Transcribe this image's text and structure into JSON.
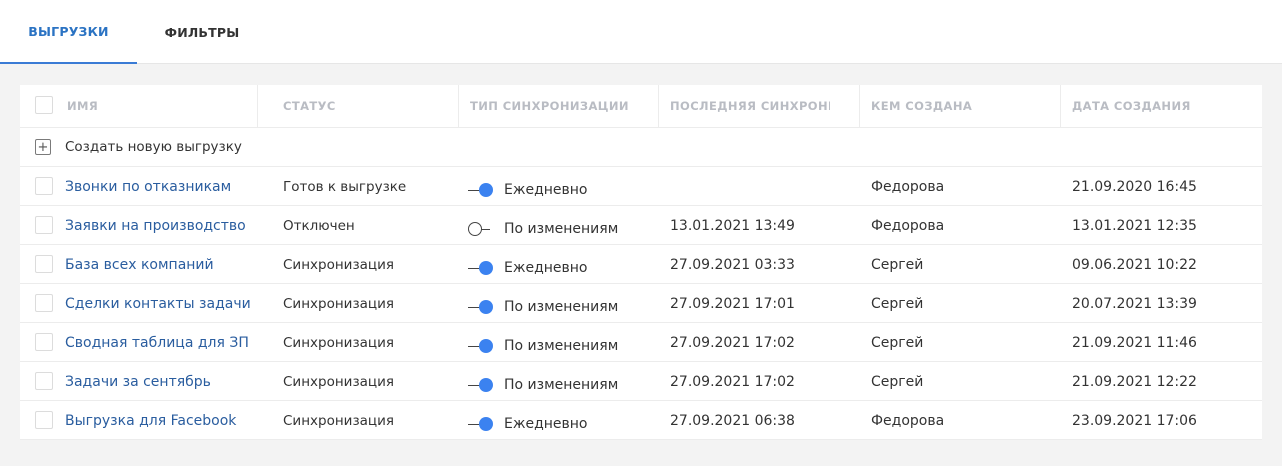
{
  "tabs": [
    {
      "label": "ВЫГРУЗКИ",
      "active": true
    },
    {
      "label": "ФИЛЬТРЫ",
      "active": false
    }
  ],
  "colors": {
    "accent": "#2b73c3",
    "toggle_on": "#3b82f0",
    "link": "#2a5d9f"
  },
  "table": {
    "columns": [
      "ИМЯ",
      "СТАТУС",
      "ТИП СИНХРОНИЗАЦИИ",
      "ПОСЛЕДНЯЯ СИНХРОНИЗАЦИЯ",
      "КЕМ СОЗДАНА",
      "ДАТА СОЗДАНИЯ"
    ],
    "create_label": "Создать новую выгрузку",
    "rows": [
      {
        "name": "Звонки по отказникам",
        "status": "Готов к выгрузке",
        "sync_on": true,
        "sync_type": "Ежедневно",
        "last_sync": "",
        "created_by": "Федорова",
        "created_at": "21.09.2020 16:45"
      },
      {
        "name": "Заявки на производство",
        "status": "Отключен",
        "sync_on": false,
        "sync_type": "По изменениям",
        "last_sync": "13.01.2021 13:49",
        "created_by": "Федорова",
        "created_at": "13.01.2021 12:35"
      },
      {
        "name": "База всех компаний",
        "status": "Синхронизация",
        "sync_on": true,
        "sync_type": "Ежедневно",
        "last_sync": "27.09.2021 03:33",
        "created_by": "Сергей",
        "created_at": "09.06.2021 10:22"
      },
      {
        "name": "Сделки контакты задачи",
        "status": "Синхронизация",
        "sync_on": true,
        "sync_type": "По изменениям",
        "last_sync": "27.09.2021 17:01",
        "created_by": "Сергей",
        "created_at": "20.07.2021 13:39"
      },
      {
        "name": "Сводная таблица для ЗП",
        "status": "Синхронизация",
        "sync_on": true,
        "sync_type": "По изменениям",
        "last_sync": "27.09.2021 17:02",
        "created_by": "Сергей",
        "created_at": "21.09.2021 11:46"
      },
      {
        "name": "Задачи за сентябрь",
        "status": "Синхронизация",
        "sync_on": true,
        "sync_type": "По изменениям",
        "last_sync": "27.09.2021 17:02",
        "created_by": "Сергей",
        "created_at": "21.09.2021 12:22"
      },
      {
        "name": "Выгрузка для Facebook",
        "status": "Синхронизация",
        "sync_on": true,
        "sync_type": "Ежедневно",
        "last_sync": "27.09.2021 06:38",
        "created_by": "Федорова",
        "created_at": "23.09.2021 17:06"
      }
    ]
  }
}
